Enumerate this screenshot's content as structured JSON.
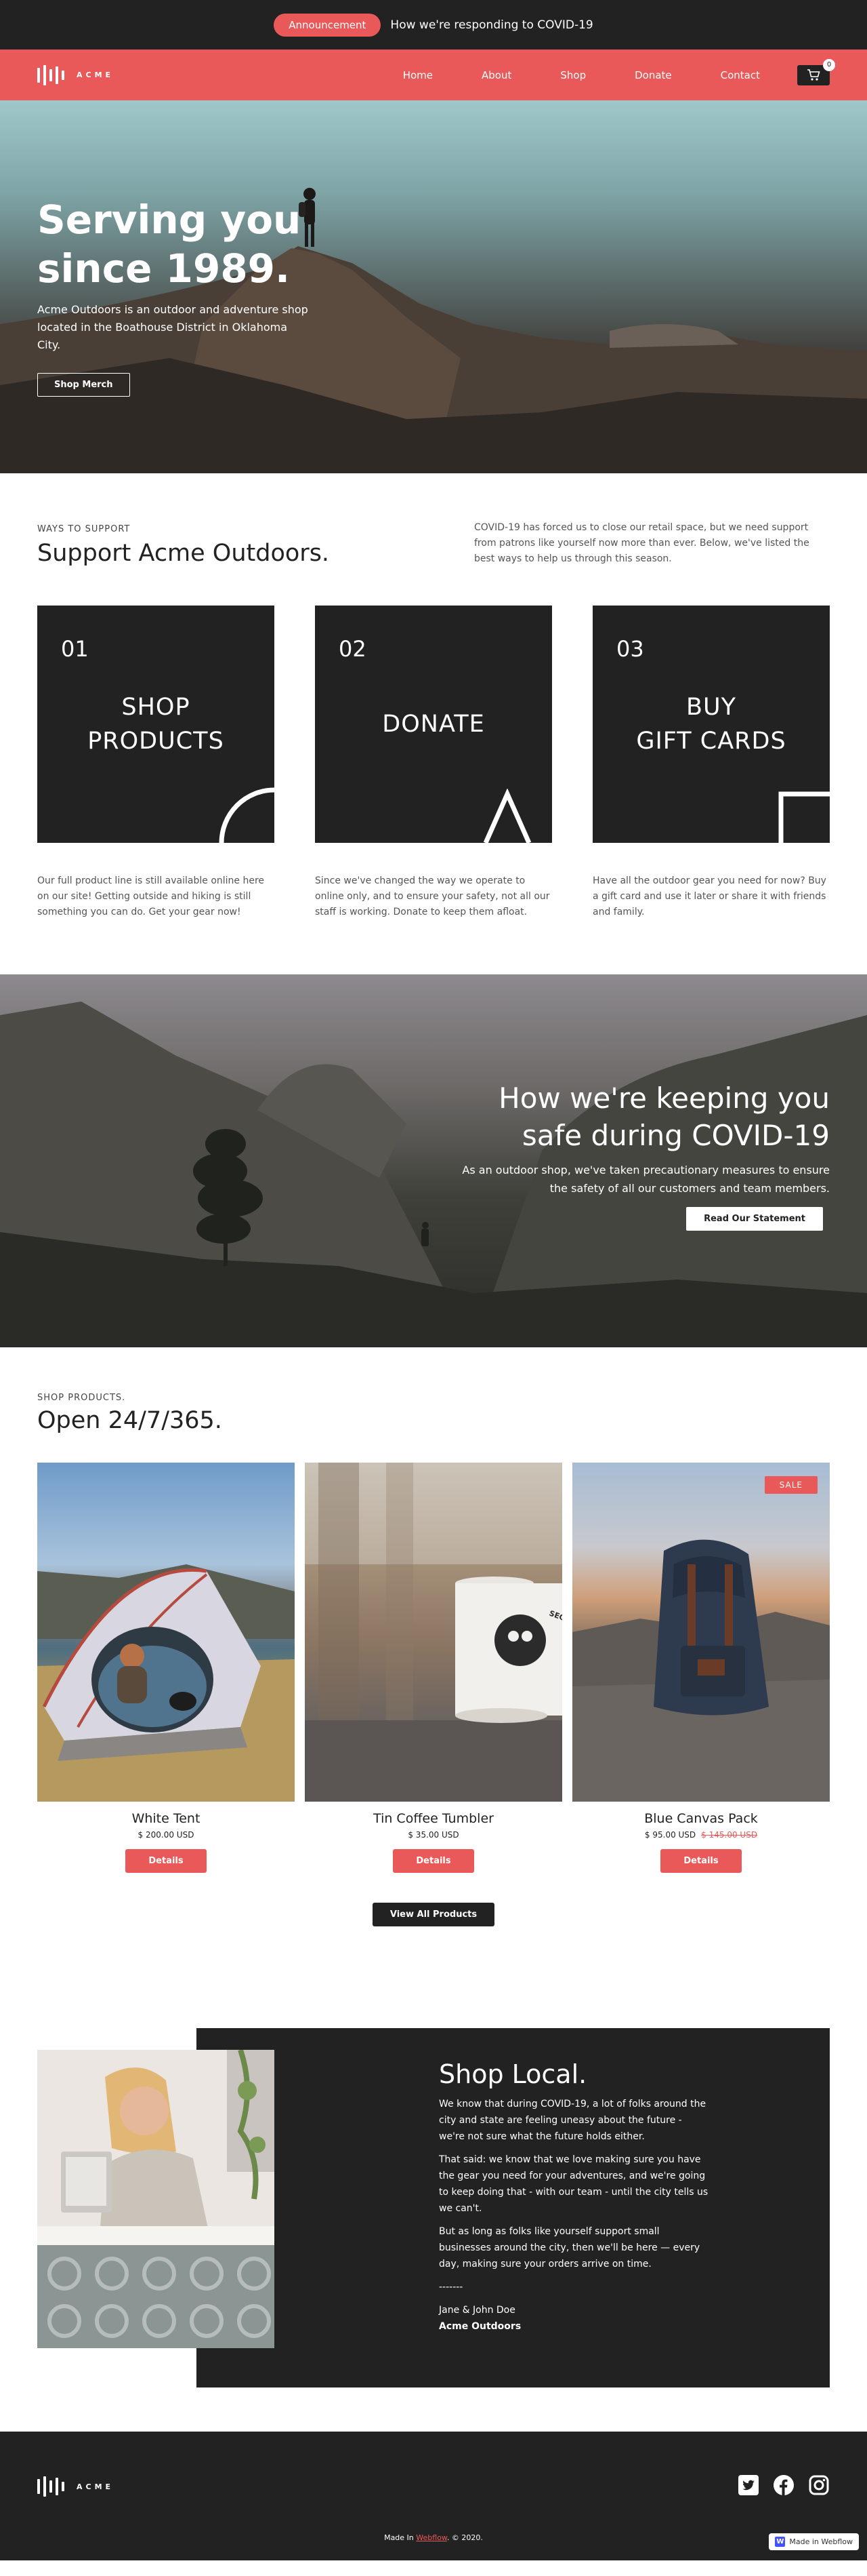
{
  "announcement": {
    "pill": "Announcement",
    "message": "How we're responding to COVID-19"
  },
  "nav": {
    "brand": "ACME",
    "links": [
      "Home",
      "About",
      "Shop",
      "Donate",
      "Contact"
    ],
    "cart_count": "0"
  },
  "hero": {
    "title_line1": "Serving you",
    "title_line2": "since 1989.",
    "description": "Acme Outdoors is an outdoor and adventure shop located in the Boathouse District in Oklahoma City.",
    "button": "Shop Merch"
  },
  "support": {
    "eyebrow": "WAYS TO SUPPORT",
    "title": "Support Acme Outdoors.",
    "intro": "COVID-19 has forced us to close our retail space, but we need support from patrons like yourself now more than ever. Below, we've listed the best ways to help us through this season.",
    "cards": [
      {
        "number": "01",
        "line1": "SHOP",
        "line2": "PRODUCTS",
        "text": "Our full product line is still available online here on our site! Getting outside and hiking is still something you can do. Get your gear now!"
      },
      {
        "number": "02",
        "line1": "DONATE",
        "line2": "",
        "text": "Since we've changed the way we operate to online only, and to ensure your safety, not all our staff is working. Donate to keep them afloat."
      },
      {
        "number": "03",
        "line1": "BUY",
        "line2": "GIFT CARDS",
        "text": "Have all the outdoor gear you need for now? Buy a gift card and use it later or share it with friends and family."
      }
    ]
  },
  "covid": {
    "title_line1": "How we're keeping you",
    "title_line2": "safe during COVID-19",
    "text": "As an outdoor shop, we've taken precautionary measures to ensure the safety of all our customers and team members.",
    "button": "Read Our Statement"
  },
  "products": {
    "eyebrow": "SHOP PRODUCTS.",
    "title": "Open 24/7/365.",
    "items": [
      {
        "name": "White Tent",
        "price": "$ 200.00 USD",
        "old_price": "",
        "button": "Details"
      },
      {
        "name": "Tin Coffee Tumbler",
        "price": "$ 35.00 USD",
        "old_price": "",
        "button": "Details"
      },
      {
        "name": "Blue Canvas Pack",
        "price": "$ 95.00 USD",
        "old_price": "$ 145.00 USD",
        "button": "Details",
        "badge": "SALE"
      }
    ],
    "mug_text": "SECRET PROJECT",
    "view_all": "View All Products"
  },
  "local": {
    "title": "Shop Local.",
    "p1": "We know that during COVID-19, a lot of folks around the city and state are feeling uneasy about the future - we're not sure what the future holds either.",
    "p2": "That said: we know that we love making sure you have the gear you need for your adventures, and we're going to keep doing that - with our team - until the city tells us we can't.",
    "p3": "But as long as folks like yourself support small businesses around the city, then we'll be here — every day, making sure your orders arrive on time.",
    "divider": "-------",
    "signature": "Jane & John Doe",
    "company": "Acme Outdoors"
  },
  "footer": {
    "brand": "ACME",
    "made_prefix": "Made In ",
    "made_link": "Webflow",
    "made_suffix": ". © 2020.",
    "badge": "Made in Webflow",
    "badge_icon": "W"
  },
  "colors": {
    "accent": "#ea5959",
    "dark": "#222222"
  }
}
